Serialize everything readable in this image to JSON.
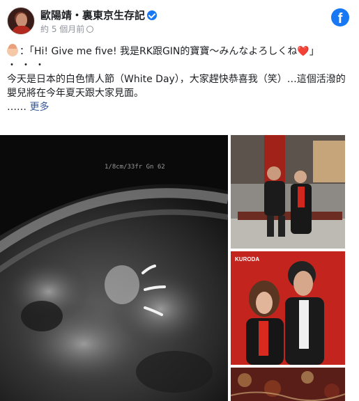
{
  "header": {
    "page_name": "歐陽靖・裏東京生存記",
    "timestamp": "約 5 個月前",
    "verified_icon": "verified-badge-icon",
    "brand_icon": "facebook-logo-icon",
    "brand_letter": "f",
    "brand_color": "#1877f2"
  },
  "post": {
    "line1_prefix": "：「Hi! Give me five! 我是RK跟GIN的寶寶〜みんなよろしくね",
    "line1_heart": "❤️",
    "line1_suffix": "」",
    "dots": "・・・",
    "body": "今天是日本的白色情人節（White Day），大家趕快恭喜我（笑）…這個活潑的嬰兒將在今年夏天跟大家見面。",
    "ellipsis": "……",
    "more_label": "更多",
    "link_color": "#385898"
  },
  "gallery": {
    "ultrasound_caption": "1/8cm/33fr  Gn 62",
    "side_caption": "KURODA"
  }
}
